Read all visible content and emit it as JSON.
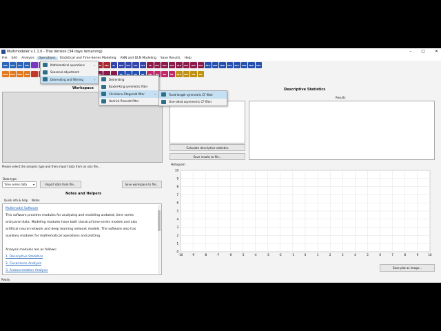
{
  "window": {
    "title": "Multimodeler v.1.1.0 - Trial Version (34 days remaining)",
    "controls": [
      "–",
      "▢",
      "✕"
    ]
  },
  "menubar": [
    "File",
    "Edit",
    "Analysis",
    "Operations",
    "Statistical and Time-Series Modeling",
    "ANN and DLN Modeling",
    "Save Results",
    "Help"
  ],
  "toolbar_row1": [
    {
      "t": "DES",
      "c": "#2b64b8"
    },
    {
      "t": "COV",
      "c": "#2b64b8"
    },
    {
      "t": "ACF",
      "c": "#2b64b8"
    },
    {
      "t": "SEP",
      "c": "#2b64b8"
    },
    {
      "t": "",
      "c": "#7a3ac0"
    },
    {
      "t": "",
      "c": "#7a3ac0"
    },
    {
      "t": "",
      "c": "#7a3ac0"
    },
    {
      "t": "",
      "c": "#2a8a3a"
    },
    {
      "t": "PT",
      "c": "#2a8a3a"
    },
    {
      "t": "",
      "c": "#2a8a3a"
    },
    {
      "t": "",
      "c": "#2a8a3a"
    },
    {
      "t": "ARI",
      "c": "#a8282e"
    },
    {
      "t": "ARO",
      "c": "#a8282e"
    },
    {
      "t": "ARI",
      "c": "#a8282e"
    },
    {
      "t": "SEA",
      "c": "#a8282e"
    },
    {
      "t": "ST",
      "c": "#3344aa"
    },
    {
      "t": "SKP",
      "c": "#3344aa"
    },
    {
      "t": "SCP",
      "c": "#3344aa"
    },
    {
      "t": "ACF",
      "c": "#3344aa"
    },
    {
      "t": "HFT",
      "c": "#3344aa"
    },
    {
      "t": "LR",
      "c": "#8b1a4a"
    },
    {
      "t": "OLS",
      "c": "#8b1a4a"
    },
    {
      "t": "OLS",
      "c": "#8b1a4a"
    },
    {
      "t": "OLS",
      "c": "#8b1a4a"
    },
    {
      "t": "OLS",
      "c": "#8b1a4a"
    },
    {
      "t": "OLS",
      "c": "#8b1a4a"
    },
    {
      "t": "OLS",
      "c": "#8b1a4a"
    },
    {
      "t": "OLS",
      "c": "#8b1a4a"
    },
    {
      "t": "MLE",
      "c": "#2550b0"
    },
    {
      "t": "MLE",
      "c": "#2550b0"
    },
    {
      "t": "MLE",
      "c": "#2550b0"
    },
    {
      "t": "MLE",
      "c": "#2550b0"
    },
    {
      "t": "MLE",
      "c": "#2550b0"
    },
    {
      "t": "MLE",
      "c": "#2550b0"
    },
    {
      "t": "MLE",
      "c": "#2550b0"
    },
    {
      "t": "MLE",
      "c": "#2550b0"
    }
  ],
  "toolbar_row2": [
    {
      "t": "SAVE",
      "c": "#e07820"
    },
    {
      "t": "HELP",
      "c": "#e07820"
    },
    {
      "t": "WEB",
      "c": "#e07820"
    },
    {
      "t": "EXIT",
      "c": "#e07820"
    },
    {
      "t": "",
      "c": "#c0392b"
    },
    {
      "t": "",
      "c": "#c0392b"
    },
    {
      "t": "",
      "c": "#c0392b"
    },
    {
      "t": "",
      "c": "#2a8a3a"
    },
    {
      "t": "",
      "c": "#2a8a3a"
    },
    {
      "t": "",
      "c": "#2a8a3a"
    },
    {
      "t": "",
      "c": "#3344aa"
    },
    {
      "t": "",
      "c": "#3344aa"
    },
    {
      "t": "",
      "c": "#3344aa"
    },
    {
      "t": "CES",
      "c": "#8b1a4a"
    },
    {
      "t": "",
      "c": "#8b1a4a"
    },
    {
      "t": "",
      "c": "#8b1a4a"
    },
    {
      "t": "NS",
      "c": "#2550b0"
    },
    {
      "t": "NS",
      "c": "#2550b0"
    },
    {
      "t": "NS",
      "c": "#2550b0"
    },
    {
      "t": "NS",
      "c": "#2550b0"
    },
    {
      "t": "NN",
      "c": "#c02a6a"
    },
    {
      "t": "NN",
      "c": "#c02a6a"
    },
    {
      "t": "RN",
      "c": "#c02a6a"
    },
    {
      "t": "RN",
      "c": "#c02a6a"
    },
    {
      "t": "MLE",
      "c": "#c09010"
    },
    {
      "t": "MLE",
      "c": "#c09010"
    },
    {
      "t": "NN",
      "c": "#c09010"
    },
    {
      "t": "NN",
      "c": "#c09010"
    }
  ],
  "ops_menu": [
    "Mathematical operations",
    "Seasonal adjustment",
    "Detrending and filtering"
  ],
  "filter_menu": [
    "Detrending",
    "Baxter-King symmetric filter",
    "Christiano-Fitzgerald filter",
    "Hodrick-Prescott filter"
  ],
  "cf_menu": [
    "Fixed-length symmetric CF filter",
    "One-sided asymmetric CF filter"
  ],
  "workspace": {
    "title": "Workspace",
    "hint": "Please select the analysis type and then import data from an xlsx file...",
    "data_type_label": "Data type:",
    "data_type_value": "Time series data",
    "import_btn": "Import data from file...",
    "save_ws_btn": "Save workspace to file..."
  },
  "notes": {
    "title": "Notes and Helpers",
    "tab_label": "Quick info & help",
    "tab_notes": "Notes",
    "heading": "Multimodel Software",
    "para": [
      "This software provides modules for analyzing and modeling undated, time series",
      "and panel data. Modeling modules have both classical time-series models and also",
      "artificial neural network and deep learning network models. The software also has",
      "auxiliary modules for mathematical operations and plotting."
    ],
    "list_intro": "Analysis modules are as follows:",
    "items": [
      "1. Descriptive Statistics",
      "2. Covariance Analysis",
      "3. Autocorrelation Analysis"
    ]
  },
  "stats": {
    "title": "Descriptive Statistics",
    "results": "Results",
    "calc_btn": "Calculate descriptive statistics",
    "save_btn": "Save results to file...",
    "histogram": "Histogram",
    "save_plot_btn": "Save plot as image..."
  },
  "chart_data": {
    "type": "scatter",
    "x_ticks": [
      "-10",
      "-9",
      "-8",
      "-7",
      "-6",
      "-5",
      "-4",
      "-3",
      "-2",
      "-1",
      "0",
      "1",
      "2",
      "3",
      "4",
      "5",
      "6",
      "7",
      "8",
      "9",
      "10"
    ],
    "y_ticks": [
      "10",
      "9",
      "8",
      "7",
      "6",
      "5",
      "4",
      "3",
      "2",
      "1",
      "0"
    ],
    "xlim": [
      -10,
      10
    ],
    "ylim": [
      0,
      10
    ],
    "grid": true
  },
  "status": "Ready"
}
